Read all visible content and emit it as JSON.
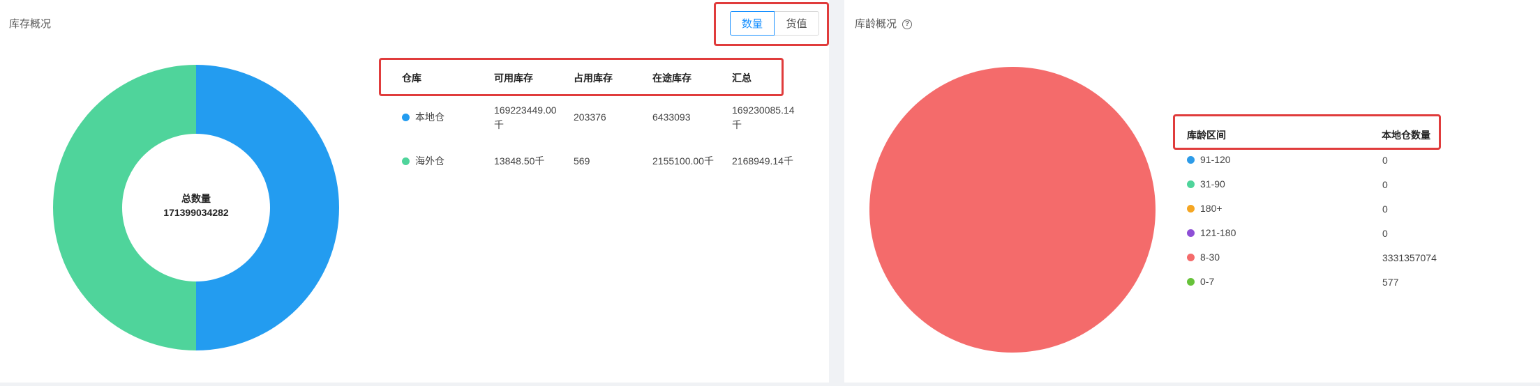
{
  "inventory_overview": {
    "title": "库存概况",
    "toggle": {
      "quantity_label": "数量",
      "value_label": "货值",
      "selected": "数量"
    },
    "donut": {
      "center_label": "总数量",
      "center_value": "171399034282",
      "slices": [
        {
          "name": "本地仓",
          "value": 169230085.14,
          "color": "#239cf0"
        },
        {
          "name": "海外仓",
          "value": 169230085.14,
          "color": "#4fd49b"
        }
      ]
    },
    "table": {
      "headers": [
        "仓库",
        "可用库存",
        "占用库存",
        "在途库存",
        "汇总"
      ],
      "rows": [
        {
          "warehouse": "本地仓",
          "color": "#239cf0",
          "available_line1": "169223449.00",
          "available_line2": "千",
          "occupied": "203376",
          "in_transit": "6433093",
          "total_line1": "169230085.14",
          "total_line2": "千"
        },
        {
          "warehouse": "海外仓",
          "color": "#4fd49b",
          "available": "13848.50千",
          "occupied": "569",
          "in_transit": "2155100.00千",
          "total": "2168949.14千"
        }
      ]
    }
  },
  "age_overview": {
    "title": "库龄概况",
    "help_icon": "question-circle-icon",
    "table": {
      "headers": [
        "库龄区间",
        "本地仓数量"
      ],
      "rows": [
        {
          "range": "91-120",
          "value": "0",
          "color": "#2d9be8"
        },
        {
          "range": "31-90",
          "value": "0",
          "color": "#4fd49b"
        },
        {
          "range": "180+",
          "value": "0",
          "color": "#f5a623"
        },
        {
          "range": "121-180",
          "value": "0",
          "color": "#8e4fd6"
        },
        {
          "range": "8-30",
          "value": "3331357074",
          "color": "#f46b6b"
        },
        {
          "range": "0-7",
          "value": "577",
          "color": "#67c23a"
        }
      ]
    },
    "pie": {
      "slices": [
        {
          "name": "8-30",
          "value": 3331357074,
          "color": "#f46b6b"
        },
        {
          "name": "0-7",
          "value": 577,
          "color": "#67c23a"
        }
      ]
    }
  }
}
